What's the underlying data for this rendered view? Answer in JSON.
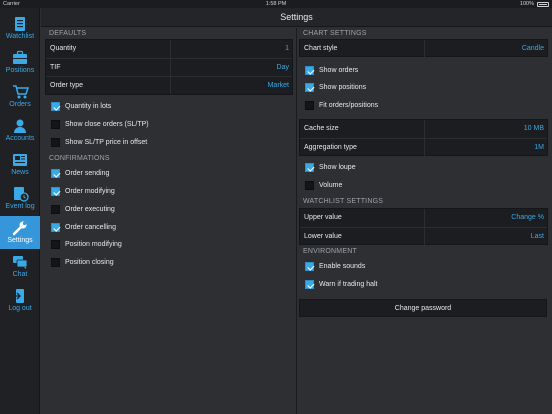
{
  "status_bar": {
    "carrier": "Carrier",
    "time": "1:58 PM",
    "battery": "100%"
  },
  "sidebar": {
    "items": [
      {
        "label": "Watchlist",
        "icon": "watchlist-icon"
      },
      {
        "label": "Positions",
        "icon": "briefcase-icon"
      },
      {
        "label": "Orders",
        "icon": "cart-icon"
      },
      {
        "label": "Accounts",
        "icon": "user-icon"
      },
      {
        "label": "News",
        "icon": "newspaper-icon"
      },
      {
        "label": "Event log",
        "icon": "event-log-icon"
      },
      {
        "label": "Settings",
        "icon": "wrench-icon"
      },
      {
        "label": "Chat",
        "icon": "chat-icon"
      },
      {
        "label": "Log out",
        "icon": "logout-icon"
      }
    ],
    "active": "Settings",
    "accent": "#3aa9e8",
    "active_bg": "#3597d9"
  },
  "header": {
    "title": "Settings"
  },
  "defaults": {
    "section": "DEFAULTS",
    "rows": [
      {
        "label": "Quantity",
        "value": "1"
      },
      {
        "label": "TIF",
        "value": "Day"
      },
      {
        "label": "Order type",
        "value": "Market"
      }
    ]
  },
  "left_toggles": [
    {
      "label": "Quantity in lots",
      "checked": true
    },
    {
      "label": "Show close orders (SL/TP)",
      "checked": false
    },
    {
      "label": "Show SL/TP price in offset",
      "checked": false
    }
  ],
  "confirmations": {
    "section": "CONFIRMATIONS",
    "items": [
      {
        "label": "Order sending",
        "checked": true
      },
      {
        "label": "Order modifying",
        "checked": true
      },
      {
        "label": "Order executing",
        "checked": false
      },
      {
        "label": "Order cancelling",
        "checked": true
      },
      {
        "label": "Position modifying",
        "checked": false
      },
      {
        "label": "Position closing",
        "checked": false
      }
    ]
  },
  "chart_settings": {
    "section": "CHART SETTINGS",
    "style_label": "Chart style",
    "style_value": "Candle",
    "toggles": [
      {
        "label": "Show orders",
        "checked": true
      },
      {
        "label": "Show positions",
        "checked": true
      },
      {
        "label": "Fit orders/positions",
        "checked": false
      }
    ]
  },
  "cache": {
    "rows": [
      {
        "label": "Cache size",
        "value": "10 MB"
      },
      {
        "label": "Aggregation type",
        "value": "1M"
      }
    ]
  },
  "chart_toggles2": [
    {
      "label": "Show loupe",
      "checked": true
    },
    {
      "label": "Volume",
      "checked": false
    }
  ],
  "watchlist_settings": {
    "section": "WATCHLIST SETTINGS",
    "rows": [
      {
        "label": "Upper value",
        "value": "Change %"
      },
      {
        "label": "Lower value",
        "value": "Last"
      }
    ]
  },
  "environment": {
    "section": "ENVIRONMENT",
    "items": [
      {
        "label": "Enable sounds",
        "checked": true
      },
      {
        "label": "Warn if trading halt",
        "checked": true
      }
    ]
  },
  "change_password": "Change password"
}
